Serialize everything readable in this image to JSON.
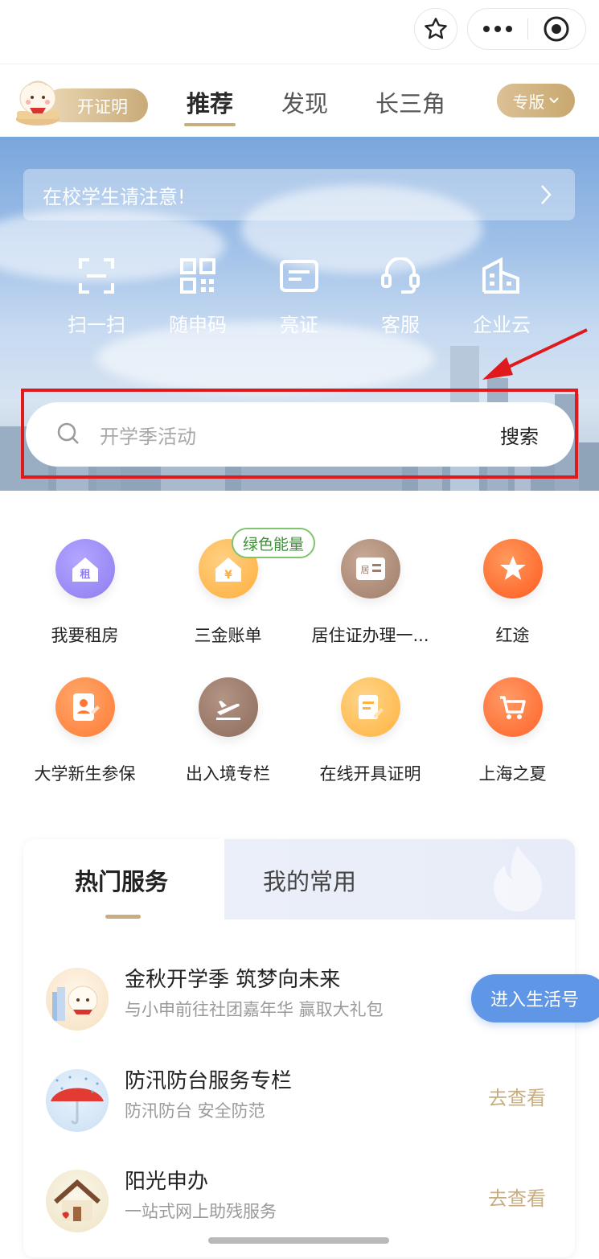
{
  "header": {
    "icons": [
      "star-icon",
      "more-dots-icon",
      "record-target-icon"
    ]
  },
  "nav": {
    "certificate_label": "开证明",
    "tabs": [
      {
        "label": "推荐",
        "active": true
      },
      {
        "label": "发现",
        "active": false
      },
      {
        "label": "长三角",
        "active": false
      }
    ],
    "edition_label": "专版"
  },
  "hero": {
    "notice": "在校学生请注意!",
    "quick_actions": [
      {
        "label": "扫一扫",
        "icon": "scan-icon"
      },
      {
        "label": "随申码",
        "icon": "qr-code-icon"
      },
      {
        "label": "亮证",
        "icon": "card-icon"
      },
      {
        "label": "客服",
        "icon": "headset-icon"
      },
      {
        "label": "企业云",
        "icon": "building-icon"
      }
    ],
    "search": {
      "placeholder": "开学季活动",
      "button": "搜索"
    }
  },
  "services": [
    {
      "label": "我要租房",
      "icon": "rent-house-icon",
      "color": "#8d7cf0"
    },
    {
      "label": "三金账单",
      "icon": "house-yuan-icon",
      "color": "#ffb24a"
    },
    {
      "label": "居住证办理一...",
      "icon": "residence-card-icon",
      "color": "#a88672"
    },
    {
      "label": "红途",
      "icon": "red-star-icon",
      "color": "#ff6a2c"
    },
    {
      "label": "大学新生参保",
      "icon": "insurance-edit-icon",
      "color": "#ff8a44"
    },
    {
      "label": "出入境专栏",
      "icon": "departure-plane-icon",
      "color": "#9c7b6a"
    },
    {
      "label": "在线开具证明",
      "icon": "document-pen-icon",
      "color": "#ffbe4f"
    },
    {
      "label": "上海之夏",
      "icon": "shopping-cart-icon",
      "color": "#ff6d3a"
    }
  ],
  "badge": "绿色能量",
  "hot": {
    "tabs": [
      "热门服务",
      "我的常用"
    ],
    "items": [
      {
        "title": "金秋开学季 筑梦向未来",
        "subtitle": "与小申前往社团嘉年华 赢取大礼包",
        "action": ""
      },
      {
        "title": "防汛防台服务专栏",
        "subtitle": "防汛防台 安全防范",
        "action": "去查看"
      },
      {
        "title": "阳光申办",
        "subtitle": "一站式网上助残服务",
        "action": "去查看"
      }
    ],
    "enter_button": "进入生活号"
  }
}
